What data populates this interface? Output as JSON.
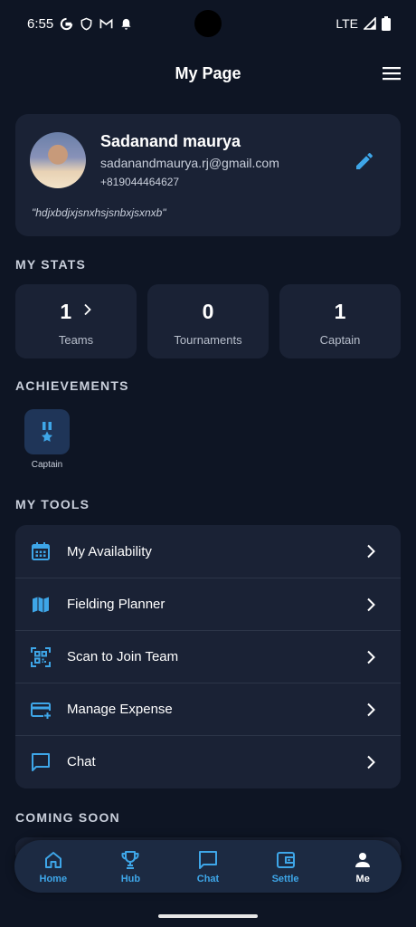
{
  "status_bar": {
    "time": "6:55",
    "network": "LTE"
  },
  "header": {
    "title": "My Page"
  },
  "profile": {
    "name": "Sadanand maurya",
    "email": "sadanandmaurya.rj@gmail.com",
    "phone": "+819044464627",
    "bio": "\"hdjxbdjxjsnxhsjsnbxjsxnxb\""
  },
  "stats_section": {
    "title": "MY STATS"
  },
  "stats": [
    {
      "value": "1",
      "label": "Teams"
    },
    {
      "value": "0",
      "label": "Tournaments"
    },
    {
      "value": "1",
      "label": "Captain"
    }
  ],
  "achievements_section": {
    "title": "ACHIEVEMENTS"
  },
  "achievements": [
    {
      "label": "Captain",
      "icon": "medal-star-icon"
    }
  ],
  "tools_section": {
    "title": "MY TOOLS"
  },
  "tools": [
    {
      "label": "My Availability",
      "icon": "calendar-icon"
    },
    {
      "label": "Fielding Planner",
      "icon": "map-icon"
    },
    {
      "label": "Scan to Join Team",
      "icon": "qr-scan-icon"
    },
    {
      "label": "Manage Expense",
      "icon": "credit-card-add-icon"
    },
    {
      "label": "Chat",
      "icon": "chat-bubble-icon"
    }
  ],
  "coming_soon_section": {
    "title": "COMING SOON"
  },
  "bottom_nav": [
    {
      "label": "Home",
      "icon": "home-icon"
    },
    {
      "label": "Hub",
      "icon": "trophy-icon"
    },
    {
      "label": "Chat",
      "icon": "chat-icon"
    },
    {
      "label": "Settle",
      "icon": "wallet-icon"
    },
    {
      "label": "Me",
      "icon": "person-icon",
      "active": true
    }
  ],
  "colors": {
    "background": "#0e1524",
    "card": "#1a2235",
    "accent": "#3ea6e8",
    "nav_background": "#1c2a42"
  }
}
